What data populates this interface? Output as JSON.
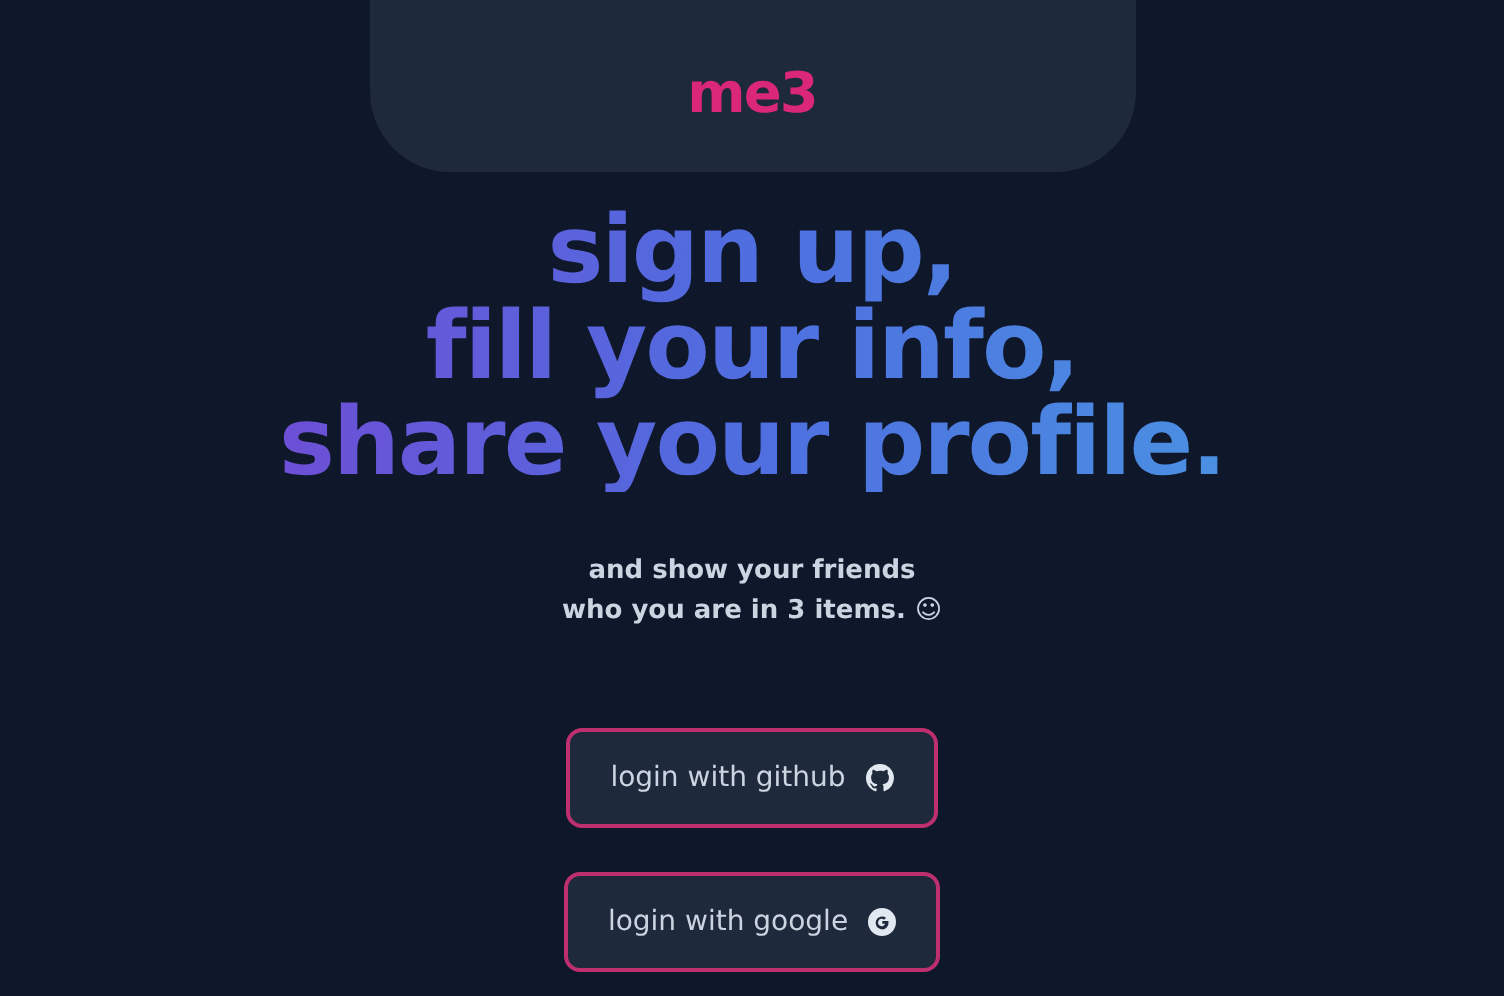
{
  "header": {
    "logo": "me3"
  },
  "headline": [
    "sign up,",
    "fill your info,",
    "share your profile."
  ],
  "subtitle": [
    "and show your friends",
    "who you are in 3 items. ☺"
  ],
  "buttons": [
    {
      "label": "login with github",
      "kind": "github"
    },
    {
      "label": "login with google",
      "kind": "google"
    }
  ]
}
